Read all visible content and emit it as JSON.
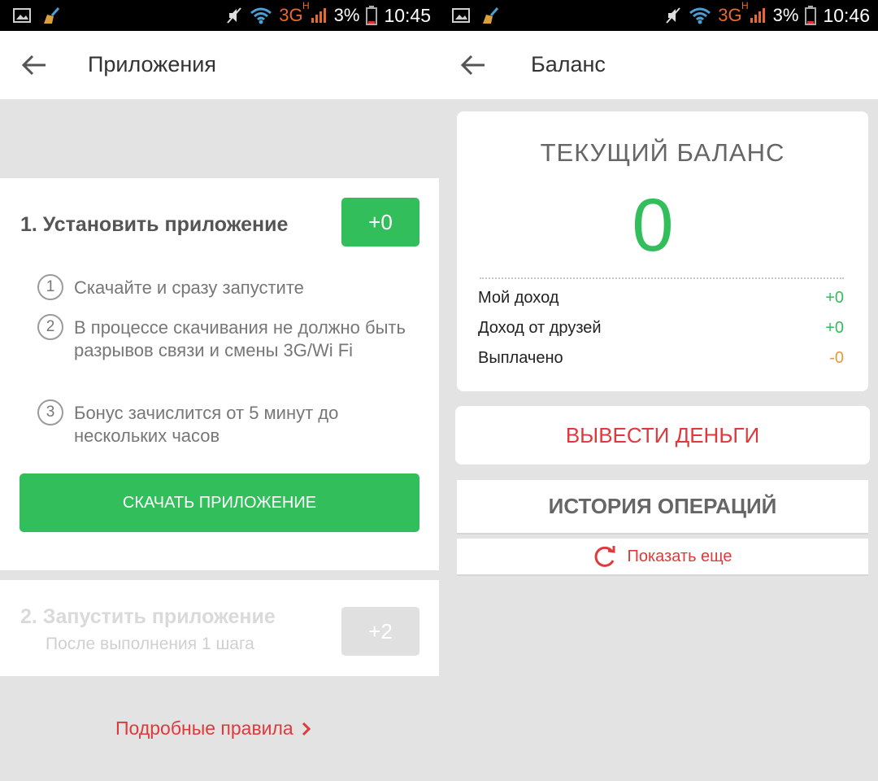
{
  "colors": {
    "accent_green": "#33be5c",
    "accent_red": "#e0393b",
    "accent_orange": "#e29a3a",
    "network_orange": "#e8692c"
  },
  "left": {
    "status": {
      "network": "3G",
      "network_sup": "H",
      "battery": "3%",
      "time": "10:45"
    },
    "appbar": {
      "title": "Приложения",
      "back_icon": "back-arrow-icon"
    },
    "step1": {
      "title": "1. Установить приложение",
      "points": "+0",
      "instructions": [
        {
          "num": "1",
          "text": "Скачайте и сразу запустите"
        },
        {
          "num": "2",
          "text": "В процессе скачивания не должно быть разрывов связи и смены 3G/Wi Fi"
        },
        {
          "num": "3",
          "text": "Бонус зачислится от 5 минут до нескольких часов"
        }
      ],
      "download_button": "СКАЧАТЬ ПРИЛОЖЕНИЕ"
    },
    "step2": {
      "title": "2. Запустить приложение",
      "subtitle": "После выполнения 1 шага",
      "points": "+2"
    },
    "rules_link": "Подробные правила"
  },
  "right": {
    "status": {
      "network": "3G",
      "network_sup": "H",
      "battery": "3%",
      "time": "10:46"
    },
    "appbar": {
      "title": "Баланс",
      "back_icon": "back-arrow-icon"
    },
    "balance": {
      "title": "ТЕКУЩИЙ БАЛАНС",
      "value": "0",
      "rows": [
        {
          "label": "Мой доход",
          "value": "+0",
          "color": "#33be5c"
        },
        {
          "label": "Доход от друзей",
          "value": "+0",
          "color": "#33be5c"
        },
        {
          "label": "Выплачено",
          "value": "-0",
          "color": "#e29a3a"
        }
      ]
    },
    "withdraw_button": "ВЫВЕСТИ ДЕНЬГИ",
    "history_header": "ИСТОРИЯ ОПЕРАЦИЙ",
    "show_more": "Показать еще"
  }
}
